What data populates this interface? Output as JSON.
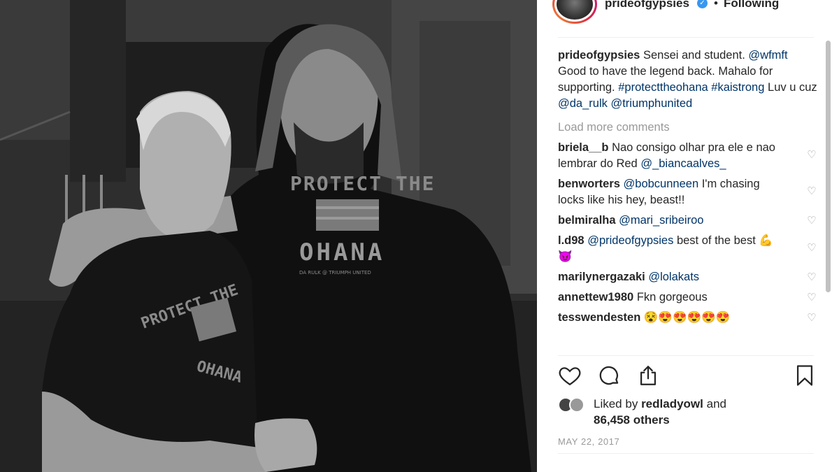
{
  "header": {
    "username": "prideofgypsies",
    "separator": "•",
    "follow_status": "Following",
    "verified_glyph": "✓"
  },
  "caption": {
    "username": "prideofgypsies",
    "text_1": "Sensei and student.",
    "mention_1": "@wfmft",
    "text_2": "Good to have the legend back. Mahalo for supporting.",
    "hashtag_1": "#protecttheohana",
    "hashtag_2": "#kaistrong",
    "text_3": "Luv u cuz",
    "mention_2": "@da_rulk",
    "mention_3": "@triumphunited"
  },
  "load_more": "Load more comments",
  "comments": [
    {
      "user": "briela__b",
      "pre": "Nao consigo olhar pra ele e nao lembrar do Red",
      "mention": "@_biancaalves_",
      "post": ""
    },
    {
      "user": "benworters",
      "pre": "",
      "mention": "@bobcunneen",
      "post": "I'm chasing locks like his hey, beast!!"
    },
    {
      "user": "belmiralha",
      "pre": "",
      "mention": "@mari_sribeiroo",
      "post": ""
    },
    {
      "user": "l.d98",
      "pre": "",
      "mention": "@prideofgypsies",
      "post": "best of the best 💪😈"
    },
    {
      "user": "marilynergazaki",
      "pre": "",
      "mention": "@lolakats",
      "post": ""
    },
    {
      "user": "annettew1980",
      "pre": "Fkn gorgeous",
      "mention": "",
      "post": ""
    },
    {
      "user": "tesswendesten",
      "pre": "😵😍😍😍😍😍",
      "mention": "",
      "post": ""
    }
  ],
  "likes": {
    "prefix": "Liked by",
    "user": "redladyowl",
    "connector": "and",
    "count": "86,458 others"
  },
  "date": "MAY 22, 2017",
  "photo": {
    "shirt_text_top": "PROTECT THE",
    "shirt_text_bottom": "OHANA",
    "shirt_small": "DA RULK @ TRIUMPH UNITED"
  },
  "icons": {
    "like": "heart-icon",
    "comment": "comment-icon",
    "share": "share-icon",
    "save": "bookmark-icon",
    "comment_like": "heart-outline-icon"
  },
  "colors": {
    "link": "#003569",
    "muted": "#999999",
    "verified": "#3897f0",
    "text": "#262626"
  }
}
